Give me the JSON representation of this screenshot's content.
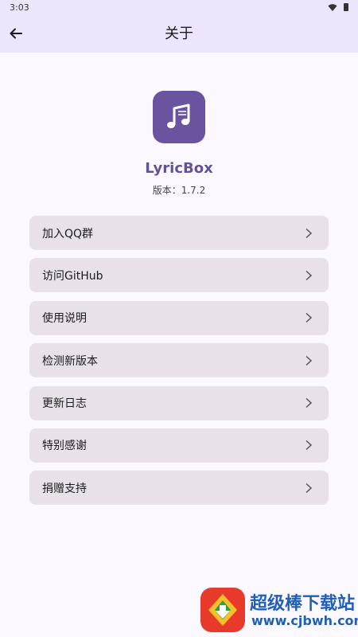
{
  "status_bar": {
    "time": "3:03",
    "icons": [
      "wifi-icon",
      "battery-icon"
    ]
  },
  "header": {
    "back_icon": "arrow-left-icon",
    "title": "关于"
  },
  "app": {
    "icon": "music-note-icon",
    "name": "LyricBox",
    "version": "版本：1.7.2",
    "icon_color": "#6a54a0",
    "name_color": "#645296"
  },
  "menu": {
    "items": [
      {
        "label": "加入QQ群"
      },
      {
        "label": "访问GitHub"
      },
      {
        "label": "使用说明"
      },
      {
        "label": "检测新版本"
      },
      {
        "label": "更新日志"
      },
      {
        "label": "特别感谢"
      },
      {
        "label": "捐赠支持"
      }
    ],
    "chevron_icon": "chevron-right-icon"
  },
  "watermark": {
    "title": "超级棒下载站",
    "url": "www.cjbwh.com"
  },
  "colors": {
    "top_bar": "#ede5fb",
    "background": "#fcf8ff",
    "menu_item_bg": "#e8e1e9"
  }
}
